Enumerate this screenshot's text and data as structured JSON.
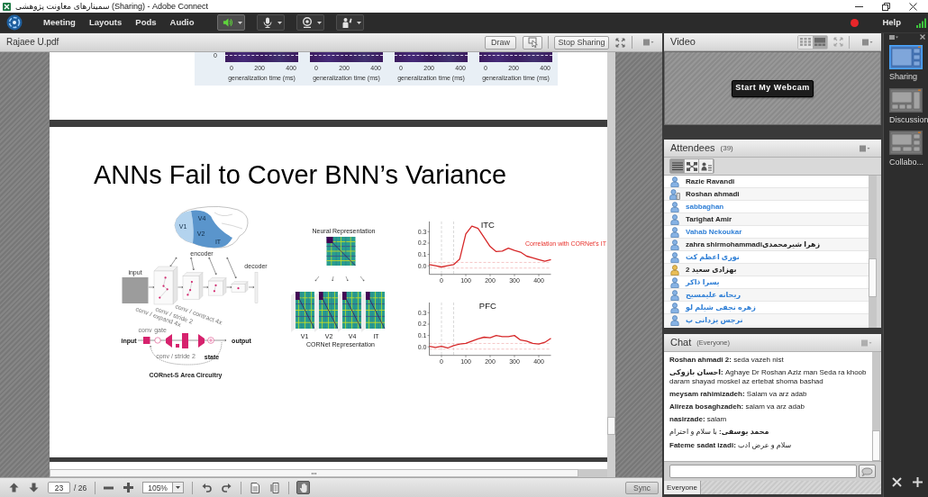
{
  "window": {
    "title": "سمینارهای معاونت پژوهشی (Sharing) - Adobe Connect"
  },
  "menu_bar": {
    "menus": [
      "Meeting",
      "Layouts",
      "Pods",
      "Audio"
    ],
    "tools": [
      {
        "kind": "speaker",
        "on": true
      },
      {
        "kind": "microphone",
        "on": false
      },
      {
        "kind": "webcam",
        "on": false
      },
      {
        "kind": "status",
        "on": false
      }
    ],
    "recording": true,
    "help": "Help"
  },
  "share_pod": {
    "title": "Rajaee U.pdf",
    "draw_button": "Draw",
    "stop_button": "Stop Sharing",
    "page_above": {
      "ytick": "0",
      "panels": [
        {
          "xticks": [
            "0",
            "200",
            "400"
          ],
          "xlabel": "generalization time (ms)"
        },
        {
          "xticks": [
            "0",
            "200",
            "400"
          ],
          "xlabel": "generalization time (ms)"
        },
        {
          "xticks": [
            "0",
            "200",
            "400"
          ],
          "xlabel": "generalization time (ms)"
        },
        {
          "xticks": [
            "0",
            "200",
            "400"
          ],
          "xlabel": "generalization time (ms)"
        }
      ]
    },
    "slide": {
      "title": "ANNs Fail to Cover BNN’s Variance",
      "architecture_figure": {
        "brain_areas": [
          "V1",
          "V4",
          "V2",
          "IT"
        ],
        "encoder": "encoder",
        "input": "input",
        "decoder": "decoder",
        "circuit": {
          "input": "input",
          "conv": "conv",
          "gate": "gate",
          "rotated": [
            "conv / expand 4x",
            "conv / stride 2",
            "conv / contract 4x"
          ],
          "lower": "conv / stride 2",
          "output": "output",
          "state": "state"
        },
        "caption": "CORnet-S Area Circuitry"
      },
      "representation_figure": {
        "top_label": "Neural Representation",
        "areas": [
          "V1",
          "V2",
          "V4",
          "IT"
        ],
        "caption": "CORNet Representation"
      },
      "plots": [
        {
          "chart_data": {
            "type": "line",
            "title": "ITC",
            "x": [
              -50,
              -25,
              0,
              25,
              50,
              75,
              100,
              125,
              150,
              175,
              200,
              225,
              250,
              275,
              300,
              325,
              350,
              375,
              400,
              425,
              450
            ],
            "series": [
              {
                "color": "#d62728",
                "values": [
                  0.01,
                  0.0,
                  -0.01,
                  0.0,
                  0.01,
                  0.06,
                  0.28,
                  0.35,
                  0.33,
                  0.25,
                  0.17,
                  0.125,
                  0.13,
                  0.155,
                  0.135,
                  0.12,
                  0.085,
                  0.07,
                  0.055,
                  0.04,
                  0.055
                ]
              }
            ],
            "xlim": [
              -50,
              450
            ],
            "ylim": [
              -0.075,
              0.39
            ],
            "xticks": [
              0,
              100,
              200,
              300,
              400
            ],
            "yticks": [
              {
                "value": 0,
                "label": "0.0"
              },
              {
                "value": 0.1,
                "label": "0.1"
              },
              {
                "value": 0.2,
                "label": "0.2"
              },
              {
                "value": 0.3,
                "label": "0.3"
              }
            ],
            "ref_lines": [
              {
                "axis": "x",
                "value": 0
              },
              {
                "axis": "x",
                "value": 50
              },
              {
                "axis": "y",
                "value": 0.03
              },
              {
                "axis": "y",
                "value": -0.02
              }
            ],
            "annotations": [
              "Correlation with CORNet's IT"
            ]
          }
        },
        {
          "chart_data": {
            "type": "line",
            "title": "PFC",
            "x": [
              -50,
              -25,
              0,
              25,
              50,
              75,
              100,
              125,
              150,
              175,
              200,
              225,
              250,
              275,
              300,
              325,
              350,
              375,
              400,
              425,
              450
            ],
            "series": [
              {
                "color": "#d62728",
                "values": [
                  0.005,
                  -0.005,
                  0.005,
                  -0.01,
                  0.01,
                  0.025,
                  0.03,
                  0.05,
                  0.07,
                  0.085,
                  0.08,
                  0.1,
                  0.09,
                  0.09,
                  0.1,
                  0.06,
                  0.05,
                  0.03,
                  0.025,
                  0.04,
                  0.075
                ]
              }
            ],
            "xlim": [
              -50,
              450
            ],
            "ylim": [
              -0.075,
              0.39
            ],
            "xticks": [
              0,
              100,
              200,
              300,
              400
            ],
            "yticks": [
              {
                "value": 0,
                "label": "0.0"
              },
              {
                "value": 0.1,
                "label": "0.1"
              },
              {
                "value": 0.2,
                "label": "0.2"
              },
              {
                "value": 0.3,
                "label": "0.3"
              }
            ],
            "ref_lines": [
              {
                "axis": "x",
                "value": 0
              },
              {
                "axis": "x",
                "value": 50
              },
              {
                "axis": "y",
                "value": 0.03
              },
              {
                "axis": "y",
                "value": -0.02
              }
            ]
          }
        }
      ]
    },
    "toolbar": {
      "page": "23",
      "page_count": "/ 26",
      "zoom": "105%",
      "hand_tool": {
        "selected": true
      },
      "sync_button": "Sync"
    }
  },
  "video_pod": {
    "title": "Video",
    "views": [
      {
        "kind": "grid",
        "selected": false
      },
      {
        "kind": "filmstrip",
        "selected": true
      }
    ],
    "webcam_button": "Start My Webcam"
  },
  "attendees_pod": {
    "title": "Attendees",
    "count": "(39)",
    "views": [
      {
        "kind": "list",
        "selected": true
      },
      {
        "kind": "breakout",
        "selected": false
      },
      {
        "kind": "roles",
        "selected": false
      }
    ],
    "attendees": [
      {
        "name": "Razie Ravandi",
        "kind": "user",
        "color": "#1f1f1f"
      },
      {
        "name": "Roshan ahmadi",
        "kind": "phone-user",
        "color": "#1f1f1f"
      },
      {
        "name": "sabbaghan",
        "kind": "user",
        "color": "#2f7fd6"
      },
      {
        "name": "Tarighat Amir",
        "kind": "user",
        "color": "#1f1f1f"
      },
      {
        "name": "Vahab Nekoukar",
        "kind": "user",
        "color": "#2f7fd6"
      },
      {
        "name": "zahra shirmohammadiزهرا شیرمحمدی",
        "kind": "user",
        "color": "#1f1f1f"
      },
      {
        "name": "نوری اعظم کت",
        "kind": "user",
        "color": "#2f7fd6"
      },
      {
        "name": "بهزادی سعید 2",
        "kind": "presenter",
        "color": "#1f1f1f"
      },
      {
        "name": "یسرا ذاکر",
        "kind": "user",
        "color": "#2f7fd6"
      },
      {
        "name": "ریحانه علیمسیح",
        "kind": "user",
        "color": "#2f7fd6"
      },
      {
        "name": "زهره نجفی شیلم لو",
        "kind": "user",
        "color": "#2f7fd6"
      },
      {
        "name": "نرجس یزدانی پ",
        "kind": "user",
        "color": "#2f7fd6"
      }
    ]
  },
  "chat_pod": {
    "title": "Chat",
    "audience": "(Everyone)",
    "messages": [
      {
        "sender": "Roshan ahmadi 2:",
        "text": "seda vazeh nist"
      },
      {
        "sender": "احسان بازوکی:",
        "text": "Aghaye Dr Roshan Aziz man Seda ra khoob daram shayad moskel az ertebat shoma bashad"
      },
      {
        "sender": "meysam rahimizadeh:",
        "text": "Salam va arz adab"
      },
      {
        "sender": "Alireza bosaghzadeh:",
        "text": "salam va arz adab"
      },
      {
        "sender": "nasirzade:",
        "text": "salam"
      },
      {
        "sender": "محمد یوسفی:",
        "text": "با سلام و احترام"
      },
      {
        "sender": "Fateme sadat izadi:",
        "text": "سلام و عرض ادب"
      }
    ],
    "tabs": [
      {
        "label": "Everyone",
        "selected": true
      }
    ]
  },
  "layouts": [
    {
      "label": "Sharing",
      "kind": "sharing",
      "selected": true
    },
    {
      "label": "Discussion",
      "kind": "discussion",
      "selected": false
    },
    {
      "label": "Collabo...",
      "kind": "collaboration",
      "selected": false
    }
  ]
}
